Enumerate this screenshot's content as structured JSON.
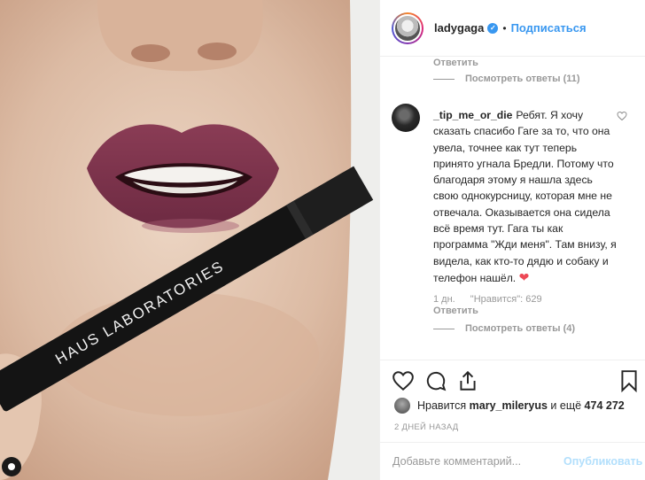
{
  "photo": {
    "pencil_text": "HAUS LABORATORIES"
  },
  "header": {
    "username": "ladygaga",
    "verified_mark": "✓",
    "separator": "•",
    "follow_label": "Подписаться"
  },
  "comments": {
    "top_reply_label": "Ответить",
    "top_view_replies": "Посмотреть ответы (11)",
    "item": {
      "username": "_tip_me_or_die",
      "text": "Ребят. Я хочу сказать спасибо Гаге за то, что она увела, точнее как тут теперь принято угнала Бредли. Потому что благодаря этому я нашла здесь свою однокурсницу, которая мне не отвечала. Оказывается она сидела всё время тут. Гага ты как программа \"Жди меня\". Там внизу, я видела, как кто-то дядю и собаку и телефон нашёл.",
      "heart": "❤",
      "age": "1 дн.",
      "likes": "\"Нравится\": 629",
      "reply_label": "Ответить",
      "view_replies": "Посмотреть ответы (4)"
    }
  },
  "likes": {
    "prefix": "Нравится",
    "user": "mary_mileryus",
    "middle": "и ещё",
    "count": "474 272"
  },
  "date": "2 ДНЕЙ НАЗАД",
  "add_comment": {
    "placeholder": "Добавьте комментарий...",
    "publish_label": "Опубликовать"
  },
  "icons": {
    "like": "heart-icon",
    "comment": "comment-icon",
    "share": "share-icon",
    "save": "bookmark-icon",
    "comment_like": "heart-outline-icon",
    "corner": "user-tag-icon"
  }
}
